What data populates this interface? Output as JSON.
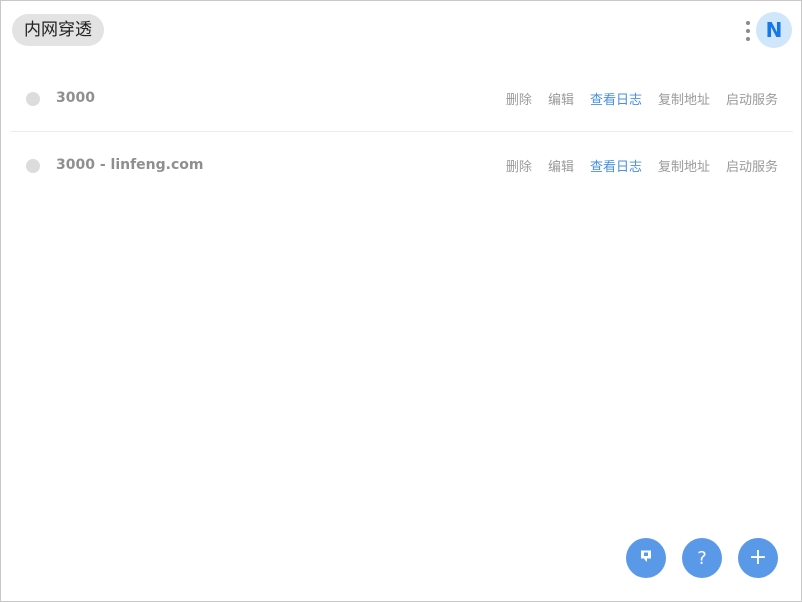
{
  "header": {
    "title": "内网穿透",
    "more_icon": "vertical-dots-icon",
    "avatar_letter": "N",
    "avatar_bg": "#cfe6fb",
    "avatar_fg": "#1677e8"
  },
  "tunnels": [
    {
      "name": "3000",
      "status_color": "#dcdcdc",
      "actions": {
        "delete": "删除",
        "edit": "编辑",
        "view_logs": "查看日志",
        "copy_address": "复制地址",
        "start_service": "启动服务"
      }
    },
    {
      "name": "3000 - linfeng.com",
      "status_color": "#dcdcdc",
      "actions": {
        "delete": "删除",
        "edit": "编辑",
        "view_logs": "查看日志",
        "copy_address": "复制地址",
        "start_service": "启动服务"
      }
    }
  ],
  "fabs": {
    "github_icon": "github-icon",
    "help_icon": "question-icon",
    "help_glyph": "?",
    "add_icon": "plus-icon",
    "add_glyph": "+",
    "color": "#5a98e8"
  },
  "colors": {
    "accent": "#4a8fe0",
    "muted_text": "#9a9a9a"
  }
}
